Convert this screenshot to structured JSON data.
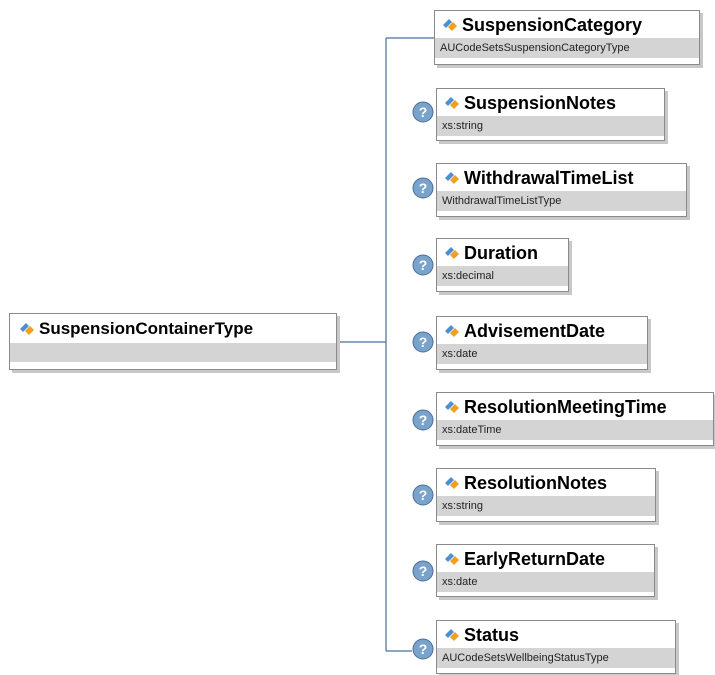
{
  "root": {
    "name": "SuspensionContainerType",
    "type": ""
  },
  "children": [
    {
      "name": "SuspensionCategory",
      "type": "AUCodeSetsSuspensionCategoryType",
      "optional": false
    },
    {
      "name": "SuspensionNotes",
      "type": "xs:string",
      "optional": true
    },
    {
      "name": "WithdrawalTimeList",
      "type": "WithdrawalTimeListType",
      "optional": true
    },
    {
      "name": "Duration",
      "type": "xs:decimal",
      "optional": true
    },
    {
      "name": "AdvisementDate",
      "type": "xs:date",
      "optional": true
    },
    {
      "name": "ResolutionMeetingTime",
      "type": "xs:dateTime",
      "optional": true
    },
    {
      "name": "ResolutionNotes",
      "type": "xs:string",
      "optional": true
    },
    {
      "name": "EarlyReturnDate",
      "type": "xs:date",
      "optional": true
    },
    {
      "name": "Status",
      "type": "AUCodeSetsWellbeingStatusType",
      "optional": true
    }
  ],
  "optional_marker": "?",
  "colors": {
    "connector": "#4a6f9a",
    "border": "#8a8a8a",
    "type_band": "#d4d4d4",
    "shadow": "#c8c8c8",
    "badge_fill": "#7aa3cc",
    "icon_blue": "#4e8fd1",
    "icon_orange": "#f0a020"
  }
}
